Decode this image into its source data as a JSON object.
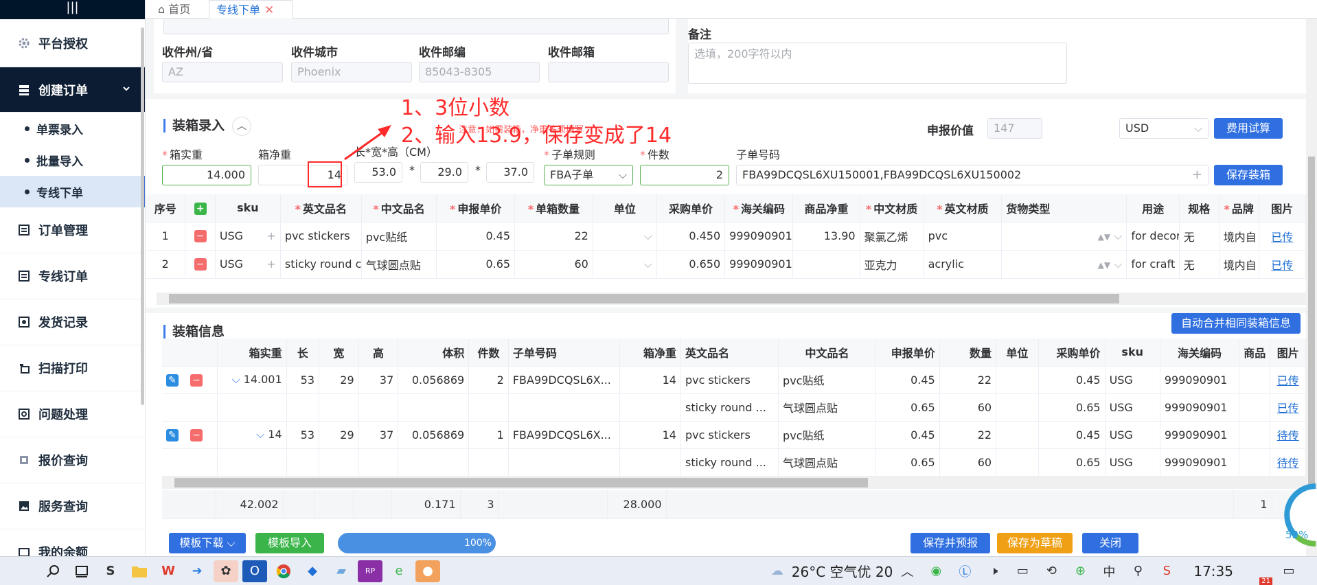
{
  "sidebar": {
    "items": [
      {
        "label": "平台授权",
        "icon": "gear-icon"
      },
      {
        "label": "创建订单",
        "icon": "stack-icon"
      },
      {
        "label": "订单管理",
        "icon": "list-icon"
      },
      {
        "label": "专线订单",
        "icon": "list-icon"
      },
      {
        "label": "发货记录",
        "icon": "record-icon"
      },
      {
        "label": "扫描打印",
        "icon": "print-icon"
      },
      {
        "label": "问题处理",
        "icon": "question-icon"
      },
      {
        "label": "报价查询",
        "icon": "quote-icon"
      },
      {
        "label": "服务查询",
        "icon": "image-icon"
      },
      {
        "label": "我的余额",
        "icon": "wallet-icon"
      }
    ],
    "sub_items": [
      "单票录入",
      "批量导入",
      "专线下单"
    ]
  },
  "tabs": {
    "home": "首页",
    "active": "专线下单"
  },
  "address": {
    "state_label": "收件州/省",
    "state_value": "AZ",
    "city_label": "收件城市",
    "city_value": "Phoenix",
    "zip_label": "收件邮编",
    "zip_value": "85043-8305",
    "email_label": "收件邮箱",
    "email_value": "",
    "remark_label": "备注",
    "remark_placeholder": "选填，200字符以内"
  },
  "packing_entry": {
    "title": "装箱录入",
    "declared_value_label": "申报价值",
    "declared_value": "147",
    "currency": "USD",
    "fee_calc_button": "费用试算",
    "gross_weight_label": "箱实重",
    "gross_weight": "14.000",
    "net_weight_label": "箱净重",
    "net_weight": "14",
    "dims_label": "长*宽*高（CM）",
    "length": "53.0",
    "width": "29.0",
    "height": "37.0",
    "sub_rule_label": "子单规则",
    "sub_rule": "FBA子单",
    "pieces_label": "件数",
    "pieces": "2",
    "sub_no_label": "子单号码",
    "sub_no": "FBA99DCQSL6XU150001,FBA99DCQSL6XU150002",
    "save_button": "保存装箱",
    "hint": "注意：如需装箱，净重等须填写"
  },
  "entry_table": {
    "headers": [
      "序号",
      "",
      "sku",
      "英文品名",
      "中文品名",
      "申报单价",
      "单箱数量",
      "单位",
      "采购单价",
      "海关编码",
      "商品净重",
      "中文材质",
      "英文材质",
      "货物类型",
      "用途",
      "规格",
      "品牌",
      "图片"
    ],
    "rows": [
      {
        "no": "1",
        "sku": "USG",
        "en": "pvc stickers",
        "cn": "pvc贴纸",
        "price": "0.45",
        "qty": "22",
        "unit": "",
        "purchase": "0.450",
        "hs": "999090901",
        "net": "13.90",
        "cn_mat": "聚氯乙烯",
        "en_mat": "pvc",
        "type": "",
        "use": "for decora",
        "spec": "无",
        "brand": "境内自",
        "img": "已传"
      },
      {
        "no": "2",
        "sku": "USG",
        "en": "sticky round c",
        "cn": "气球圆点贴",
        "price": "0.65",
        "qty": "60",
        "unit": "",
        "purchase": "0.650",
        "hs": "999090901",
        "net": "",
        "cn_mat": "亚克力",
        "en_mat": "acrylic",
        "type": "",
        "use": "for craft",
        "spec": "无",
        "brand": "境内自",
        "img": "已传"
      }
    ]
  },
  "packing_info": {
    "title": "装箱信息",
    "merge_button": "自动合并相同装箱信息",
    "headers": [
      "",
      "箱实重",
      "长",
      "宽",
      "高",
      "体积",
      "件数",
      "子单号码",
      "箱净重",
      "英文品名",
      "中文品名",
      "申报单价",
      "数量",
      "单位",
      "采购单价",
      "sku",
      "海关编码",
      "商品",
      "图片"
    ],
    "rows": [
      {
        "gross": "14.001",
        "l": "53",
        "w": "29",
        "h": "37",
        "vol": "0.056869",
        "pcs": "2",
        "sub": "FBA99DCQSL6X...",
        "net": "14",
        "en": "pvc stickers",
        "cn": "pvc贴纸",
        "price": "0.45",
        "qty": "22",
        "unit": "",
        "purchase": "0.45",
        "sku": "USG",
        "hs": "999090901",
        "img": "已传"
      },
      {
        "gross": "",
        "l": "",
        "w": "",
        "h": "",
        "vol": "",
        "pcs": "",
        "sub": "",
        "net": "",
        "en": "sticky round ...",
        "cn": "气球圆点贴",
        "price": "0.65",
        "qty": "60",
        "unit": "",
        "purchase": "0.65",
        "sku": "USG",
        "hs": "999090901",
        "img": "已传"
      },
      {
        "gross": "14",
        "l": "53",
        "w": "29",
        "h": "37",
        "vol": "0.056869",
        "pcs": "1",
        "sub": "FBA99DCQSL6X...",
        "net": "14",
        "en": "pvc stickers",
        "cn": "pvc贴纸",
        "price": "0.45",
        "qty": "22",
        "unit": "",
        "purchase": "0.45",
        "sku": "USG",
        "hs": "999090901",
        "img": "待传"
      },
      {
        "gross": "",
        "l": "",
        "w": "",
        "h": "",
        "vol": "",
        "pcs": "",
        "sub": "",
        "net": "",
        "en": "sticky round ...",
        "cn": "气球圆点贴",
        "price": "0.65",
        "qty": "60",
        "unit": "",
        "purchase": "0.65",
        "sku": "USG",
        "hs": "999090901",
        "img": "待传"
      }
    ],
    "sum": {
      "gross": "42.002",
      "vol": "0.171",
      "pcs": "3",
      "net": "28.000",
      "last": "1"
    }
  },
  "footer": {
    "template_download": "模板下载",
    "template_import": "模板导入",
    "progress": "100%",
    "save_preview": "保存并预报",
    "save_draft": "保存为草稿",
    "close": "关闭"
  },
  "annotation": {
    "line1": "1、3位小数",
    "line2": "2、输入13.9，保存变成了14"
  },
  "widget": {
    "percent": "53%"
  },
  "taskbar": {
    "weather": "26°C 空气优 20",
    "time": "17:35",
    "badge": "21"
  }
}
